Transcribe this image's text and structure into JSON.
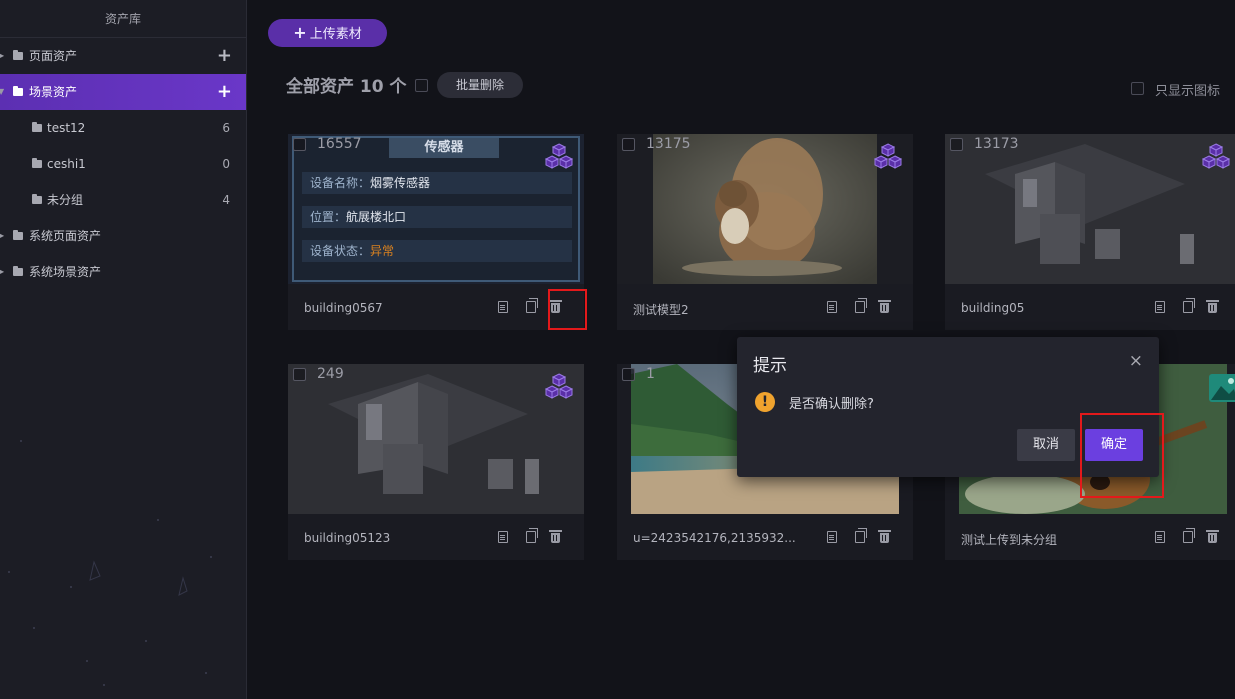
{
  "sidebar": {
    "title": "资产库",
    "items": [
      {
        "label": "页面资产",
        "action": "+"
      },
      {
        "label": "场景资产",
        "action": "+"
      },
      {
        "label": "test12",
        "count": "6"
      },
      {
        "label": "ceshi1",
        "count": "0"
      },
      {
        "label": "未分组",
        "count": "4"
      },
      {
        "label": "系统页面资产"
      },
      {
        "label": "系统场景资产"
      }
    ]
  },
  "toolbar": {
    "upload_label": "上传素材",
    "heading": "全部资产 10 个",
    "batch_delete_label": "批量删除",
    "only_icons_label": "只显示图标"
  },
  "cards": [
    {
      "id": "16557",
      "name": "building0567"
    },
    {
      "id": "13175",
      "name": "测试模型2"
    },
    {
      "id": "13173",
      "name": "building05"
    },
    {
      "id": "249",
      "name": "building05123"
    },
    {
      "id": "1",
      "name": "u=2423542176,2135932..."
    },
    {
      "id": "",
      "name": "测试上传到未分组"
    }
  ],
  "sensor_preview": {
    "title": "传感器",
    "rows": [
      {
        "label": "设备名称：",
        "value": "烟雾传感器"
      },
      {
        "label": "位置：",
        "value": "航展楼北口"
      },
      {
        "label": "设备状态：",
        "value": "异常"
      }
    ]
  },
  "dialog": {
    "title": "提示",
    "message": "是否确认删除?",
    "cancel_label": "取消",
    "confirm_label": "确定",
    "close_symbol": "×",
    "warning_symbol": "!"
  },
  "colors": {
    "accent": "#6b3fe0",
    "highlight": "#e3191b",
    "warning": "#f0a32e"
  }
}
